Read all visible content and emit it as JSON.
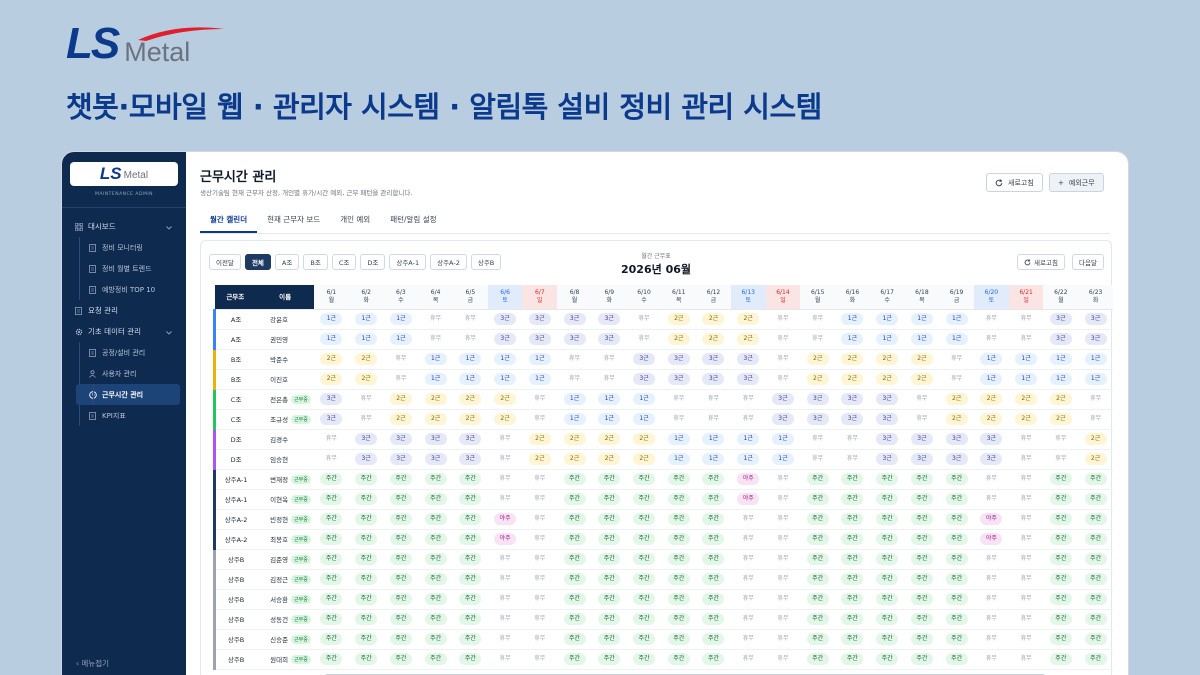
{
  "brand": {
    "ls": "LS",
    "metal": "Metal"
  },
  "headline": "챗봇·모바일 웹 · 관리자 시스템 · 알림톡 설비 정비 관리 시스템",
  "colors": {
    "primary": "#0b3a8c",
    "sidebar": "#0f2a4f",
    "swoosh": "#e11d2e"
  },
  "sidebar": {
    "logo_ls": "LS",
    "logo_metal": "Metal",
    "subtitle": "MAINTENANCE ADMIN",
    "items": [
      {
        "label": "대시보드",
        "icon": "grid-icon",
        "type": "parent",
        "expanded": true
      },
      {
        "label": "정비 모니터링",
        "icon": "doc-icon",
        "type": "child"
      },
      {
        "label": "정비 월별 트렌드",
        "icon": "doc-icon",
        "type": "child"
      },
      {
        "label": "예방정비 TOP 10",
        "icon": "doc-icon",
        "type": "child"
      },
      {
        "label": "요청 관리",
        "icon": "doc-icon",
        "type": "parent"
      },
      {
        "label": "기초 데이터 관리",
        "icon": "gear-icon",
        "type": "parent",
        "expanded": true
      },
      {
        "label": "공정/설비 관리",
        "icon": "doc-icon",
        "type": "child"
      },
      {
        "label": "사용자 관리",
        "icon": "user-icon",
        "type": "child"
      },
      {
        "label": "근무시간 관리",
        "icon": "clock-icon",
        "type": "child",
        "active": true
      },
      {
        "label": "KPI지표",
        "icon": "doc-icon",
        "type": "child"
      }
    ],
    "footer": "메뉴접기"
  },
  "page": {
    "title": "근무시간 관리",
    "subtitle": "생산기술팀 현재 근무자 산정, 개인별 휴가/시간 예외, 근무 패턴을 관리합니다.",
    "refresh_label": "새로고침",
    "exception_label": "예외근무",
    "tabs": [
      "월간 캘린더",
      "현재 근무자 보드",
      "개인 예외",
      "패턴/알림 설정"
    ]
  },
  "calendar": {
    "prev_label": "이전달",
    "next_label": "다음달",
    "refresh_label": "새로고침",
    "filters": [
      "전체",
      "A조",
      "B조",
      "C조",
      "D조",
      "상주A-1",
      "상주A-2",
      "상주B"
    ],
    "active_filter": "전체",
    "month_label": "월간 근무표",
    "month": "2026년 06월",
    "header_team": "근무조",
    "header_name": "이름",
    "days": [
      {
        "d": "6/1",
        "w": "월"
      },
      {
        "d": "6/2",
        "w": "화"
      },
      {
        "d": "6/3",
        "w": "수"
      },
      {
        "d": "6/4",
        "w": "목"
      },
      {
        "d": "6/5",
        "w": "금"
      },
      {
        "d": "6/6",
        "w": "토"
      },
      {
        "d": "6/7",
        "w": "일"
      },
      {
        "d": "6/8",
        "w": "월"
      },
      {
        "d": "6/9",
        "w": "화"
      },
      {
        "d": "6/10",
        "w": "수"
      },
      {
        "d": "6/11",
        "w": "목"
      },
      {
        "d": "6/12",
        "w": "금"
      },
      {
        "d": "6/13",
        "w": "토"
      },
      {
        "d": "6/14",
        "w": "일"
      },
      {
        "d": "6/15",
        "w": "월"
      },
      {
        "d": "6/16",
        "w": "화"
      },
      {
        "d": "6/17",
        "w": "수"
      },
      {
        "d": "6/18",
        "w": "목"
      },
      {
        "d": "6/19",
        "w": "금"
      },
      {
        "d": "6/20",
        "w": "토"
      },
      {
        "d": "6/21",
        "w": "일"
      },
      {
        "d": "6/22",
        "w": "월"
      },
      {
        "d": "6/23",
        "w": "화"
      }
    ],
    "team_colors": {
      "A조": "#3b82f6",
      "B조": "#eab308",
      "C조": "#22c55e",
      "D조": "#a855f7",
      "상주A-1": "#1e3a63",
      "상주A-2": "#1e3a63",
      "상주B": "#9ca3af"
    },
    "badge_label": "근무중",
    "rows": [
      {
        "team": "A조",
        "name": "강윤호",
        "badge": false,
        "s": [
          "1근",
          "1근",
          "1근",
          "휴무",
          "휴무",
          "3근",
          "3근",
          "3근",
          "3근",
          "휴무",
          "2근",
          "2근",
          "2근",
          "휴무",
          "휴무",
          "1근",
          "1근",
          "1근",
          "1근",
          "휴무",
          "휴무",
          "3근",
          "3근"
        ]
      },
      {
        "team": "A조",
        "name": "권민영",
        "badge": false,
        "s": [
          "1근",
          "1근",
          "1근",
          "휴무",
          "휴무",
          "3근",
          "3근",
          "3근",
          "3근",
          "휴무",
          "2근",
          "2근",
          "2근",
          "휴무",
          "휴무",
          "1근",
          "1근",
          "1근",
          "1근",
          "휴무",
          "휴무",
          "3근",
          "3근"
        ]
      },
      {
        "team": "B조",
        "name": "박준수",
        "badge": false,
        "s": [
          "2근",
          "2근",
          "휴무",
          "1근",
          "1근",
          "1근",
          "1근",
          "휴무",
          "휴무",
          "3근",
          "3근",
          "3근",
          "3근",
          "휴무",
          "2근",
          "2근",
          "2근",
          "2근",
          "휴무",
          "1근",
          "1근",
          "1근",
          "1근"
        ]
      },
      {
        "team": "B조",
        "name": "이진호",
        "badge": false,
        "s": [
          "2근",
          "2근",
          "휴무",
          "1근",
          "1근",
          "1근",
          "1근",
          "휴무",
          "휴무",
          "3근",
          "3근",
          "3근",
          "3근",
          "휴무",
          "2근",
          "2근",
          "2근",
          "2근",
          "휴무",
          "1근",
          "1근",
          "1근",
          "1근"
        ]
      },
      {
        "team": "C조",
        "name": "전은총",
        "badge": true,
        "s": [
          "3근",
          "휴무",
          "2근",
          "2근",
          "2근",
          "2근",
          "휴무",
          "1근",
          "1근",
          "1근",
          "휴무",
          "휴무",
          "휴무",
          "3근",
          "3근",
          "3근",
          "3근",
          "휴무",
          "2근",
          "2근",
          "2근",
          "2근",
          "휴무"
        ]
      },
      {
        "team": "C조",
        "name": "조규성",
        "badge": true,
        "s": [
          "3근",
          "휴무",
          "2근",
          "2근",
          "2근",
          "2근",
          "휴무",
          "1근",
          "1근",
          "1근",
          "휴무",
          "휴무",
          "휴무",
          "3근",
          "3근",
          "3근",
          "3근",
          "휴무",
          "2근",
          "2근",
          "2근",
          "2근",
          "휴무"
        ]
      },
      {
        "team": "D조",
        "name": "김경수",
        "badge": false,
        "s": [
          "휴무",
          "3근",
          "3근",
          "3근",
          "3근",
          "휴무",
          "2근",
          "2근",
          "2근",
          "2근",
          "1근",
          "1근",
          "1근",
          "1근",
          "휴무",
          "휴무",
          "3근",
          "3근",
          "3근",
          "3근",
          "휴무",
          "휴무",
          "2근"
        ]
      },
      {
        "team": "D조",
        "name": "임승현",
        "badge": false,
        "s": [
          "휴무",
          "3근",
          "3근",
          "3근",
          "3근",
          "휴무",
          "2근",
          "2근",
          "2근",
          "2근",
          "1근",
          "1근",
          "1근",
          "1근",
          "휴무",
          "휴무",
          "3근",
          "3근",
          "3근",
          "3근",
          "휴무",
          "휴무",
          "2근"
        ]
      },
      {
        "team": "상주A-1",
        "name": "변재정",
        "badge": true,
        "s": [
          "주간",
          "주간",
          "주간",
          "주간",
          "주간",
          "휴무",
          "휴무",
          "주간",
          "주간",
          "주간",
          "주간",
          "주간",
          "야주",
          "휴무",
          "주간",
          "주간",
          "주간",
          "주간",
          "주간",
          "휴무",
          "휴무",
          "주간",
          "주간"
        ]
      },
      {
        "team": "상주A-1",
        "name": "이현옥",
        "badge": true,
        "s": [
          "주간",
          "주간",
          "주간",
          "주간",
          "주간",
          "휴무",
          "휴무",
          "주간",
          "주간",
          "주간",
          "주간",
          "주간",
          "야주",
          "휴무",
          "주간",
          "주간",
          "주간",
          "주간",
          "주간",
          "휴무",
          "휴무",
          "주간",
          "주간"
        ]
      },
      {
        "team": "상주A-2",
        "name": "빈정현",
        "badge": true,
        "s": [
          "주간",
          "주간",
          "주간",
          "주간",
          "주간",
          "야주",
          "휴무",
          "주간",
          "주간",
          "주간",
          "주간",
          "주간",
          "휴무",
          "휴무",
          "주간",
          "주간",
          "주간",
          "주간",
          "주간",
          "야주",
          "휴무",
          "주간",
          "주간"
        ]
      },
      {
        "team": "상주A-2",
        "name": "최봉호",
        "badge": true,
        "s": [
          "주간",
          "주간",
          "주간",
          "주간",
          "주간",
          "야주",
          "휴무",
          "주간",
          "주간",
          "주간",
          "주간",
          "주간",
          "휴무",
          "휴무",
          "주간",
          "주간",
          "주간",
          "주간",
          "주간",
          "야주",
          "휴무",
          "주간",
          "주간"
        ]
      },
      {
        "team": "상주B",
        "name": "김준영",
        "badge": true,
        "s": [
          "주간",
          "주간",
          "주간",
          "주간",
          "주간",
          "휴무",
          "휴무",
          "주간",
          "주간",
          "주간",
          "주간",
          "주간",
          "휴무",
          "휴무",
          "주간",
          "주간",
          "주간",
          "주간",
          "주간",
          "휴무",
          "휴무",
          "주간",
          "주간"
        ]
      },
      {
        "team": "상주B",
        "name": "김정근",
        "badge": true,
        "s": [
          "주간",
          "주간",
          "주간",
          "주간",
          "주간",
          "휴무",
          "휴무",
          "주간",
          "주간",
          "주간",
          "주간",
          "주간",
          "휴무",
          "휴무",
          "주간",
          "주간",
          "주간",
          "주간",
          "주간",
          "휴무",
          "휴무",
          "주간",
          "주간"
        ]
      },
      {
        "team": "상주B",
        "name": "서승환",
        "badge": true,
        "s": [
          "주간",
          "주간",
          "주간",
          "주간",
          "주간",
          "휴무",
          "휴무",
          "주간",
          "주간",
          "주간",
          "주간",
          "주간",
          "휴무",
          "휴무",
          "주간",
          "주간",
          "주간",
          "주간",
          "주간",
          "휴무",
          "휴무",
          "주간",
          "주간"
        ]
      },
      {
        "team": "상주B",
        "name": "성동건",
        "badge": true,
        "s": [
          "주간",
          "주간",
          "주간",
          "주간",
          "주간",
          "휴무",
          "휴무",
          "주간",
          "주간",
          "주간",
          "주간",
          "주간",
          "휴무",
          "휴무",
          "주간",
          "주간",
          "주간",
          "주간",
          "주간",
          "휴무",
          "휴무",
          "주간",
          "주간"
        ]
      },
      {
        "team": "상주B",
        "name": "신승준",
        "badge": true,
        "s": [
          "주간",
          "주간",
          "주간",
          "주간",
          "주간",
          "휴무",
          "휴무",
          "주간",
          "주간",
          "주간",
          "주간",
          "주간",
          "휴무",
          "휴무",
          "주간",
          "주간",
          "주간",
          "주간",
          "주간",
          "휴무",
          "휴무",
          "주간",
          "주간"
        ]
      },
      {
        "team": "상주B",
        "name": "원대희",
        "badge": true,
        "s": [
          "주간",
          "주간",
          "주간",
          "주간",
          "주간",
          "휴무",
          "휴무",
          "주간",
          "주간",
          "주간",
          "주간",
          "주간",
          "휴무",
          "휴무",
          "주간",
          "주간",
          "주간",
          "주간",
          "주간",
          "휴무",
          "휴무",
          "주간",
          "주간"
        ]
      }
    ]
  }
}
